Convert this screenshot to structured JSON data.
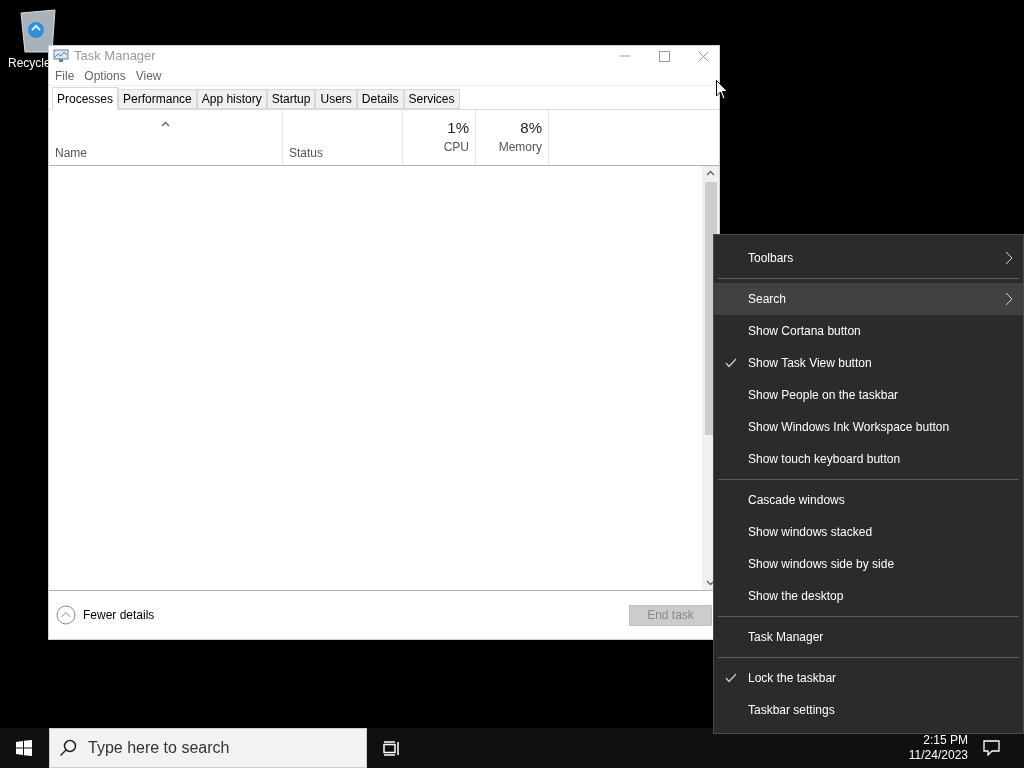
{
  "desktop": {
    "icons": [
      {
        "label": "Recycle"
      }
    ]
  },
  "task_manager": {
    "title": "Task Manager",
    "menu": [
      "File",
      "Options",
      "View"
    ],
    "tabs": [
      {
        "label": "Processes",
        "selected": true
      },
      {
        "label": "Performance",
        "selected": false
      },
      {
        "label": "App history",
        "selected": false
      },
      {
        "label": "Startup",
        "selected": false
      },
      {
        "label": "Users",
        "selected": false
      },
      {
        "label": "Details",
        "selected": false
      },
      {
        "label": "Services",
        "selected": false
      }
    ],
    "columns": [
      {
        "label": "Name",
        "sorted": true
      },
      {
        "label": "Status",
        "sorted": false
      },
      {
        "label": "CPU",
        "summary": "1%",
        "sorted": false
      },
      {
        "label": "Memory",
        "summary": "8%",
        "sorted": false
      }
    ],
    "footer": {
      "toggle": "Fewer details",
      "end_task": {
        "label": "End task",
        "disabled": true
      }
    }
  },
  "context_menu": {
    "groups": [
      [
        {
          "label": "Toolbars",
          "submenu": true,
          "checked": false,
          "selected": false
        }
      ],
      [
        {
          "label": "Search",
          "submenu": true,
          "checked": false,
          "selected": true
        },
        {
          "label": "Show Cortana button",
          "submenu": false,
          "checked": false,
          "selected": false
        },
        {
          "label": "Show Task View button",
          "submenu": false,
          "checked": true,
          "selected": false
        },
        {
          "label": "Show People on the taskbar",
          "submenu": false,
          "checked": false,
          "selected": false
        },
        {
          "label": "Show Windows Ink Workspace button",
          "submenu": false,
          "checked": false,
          "selected": false
        },
        {
          "label": "Show touch keyboard button",
          "submenu": false,
          "checked": false,
          "selected": false
        }
      ],
      [
        {
          "label": "Cascade windows",
          "submenu": false,
          "checked": false,
          "selected": false
        },
        {
          "label": "Show windows stacked",
          "submenu": false,
          "checked": false,
          "selected": false
        },
        {
          "label": "Show windows side by side",
          "submenu": false,
          "checked": false,
          "selected": false
        },
        {
          "label": "Show the desktop",
          "submenu": false,
          "checked": false,
          "selected": false
        }
      ],
      [
        {
          "label": "Task Manager",
          "submenu": false,
          "checked": false,
          "selected": false
        }
      ],
      [
        {
          "label": "Lock the taskbar",
          "submenu": false,
          "checked": true,
          "selected": false
        },
        {
          "label": "Taskbar settings",
          "submenu": false,
          "checked": false,
          "selected": false
        }
      ]
    ]
  },
  "taskbar": {
    "search": {
      "placeholder": "Type here to search"
    },
    "time": "2:15 PM",
    "date": "11/24/2023"
  }
}
